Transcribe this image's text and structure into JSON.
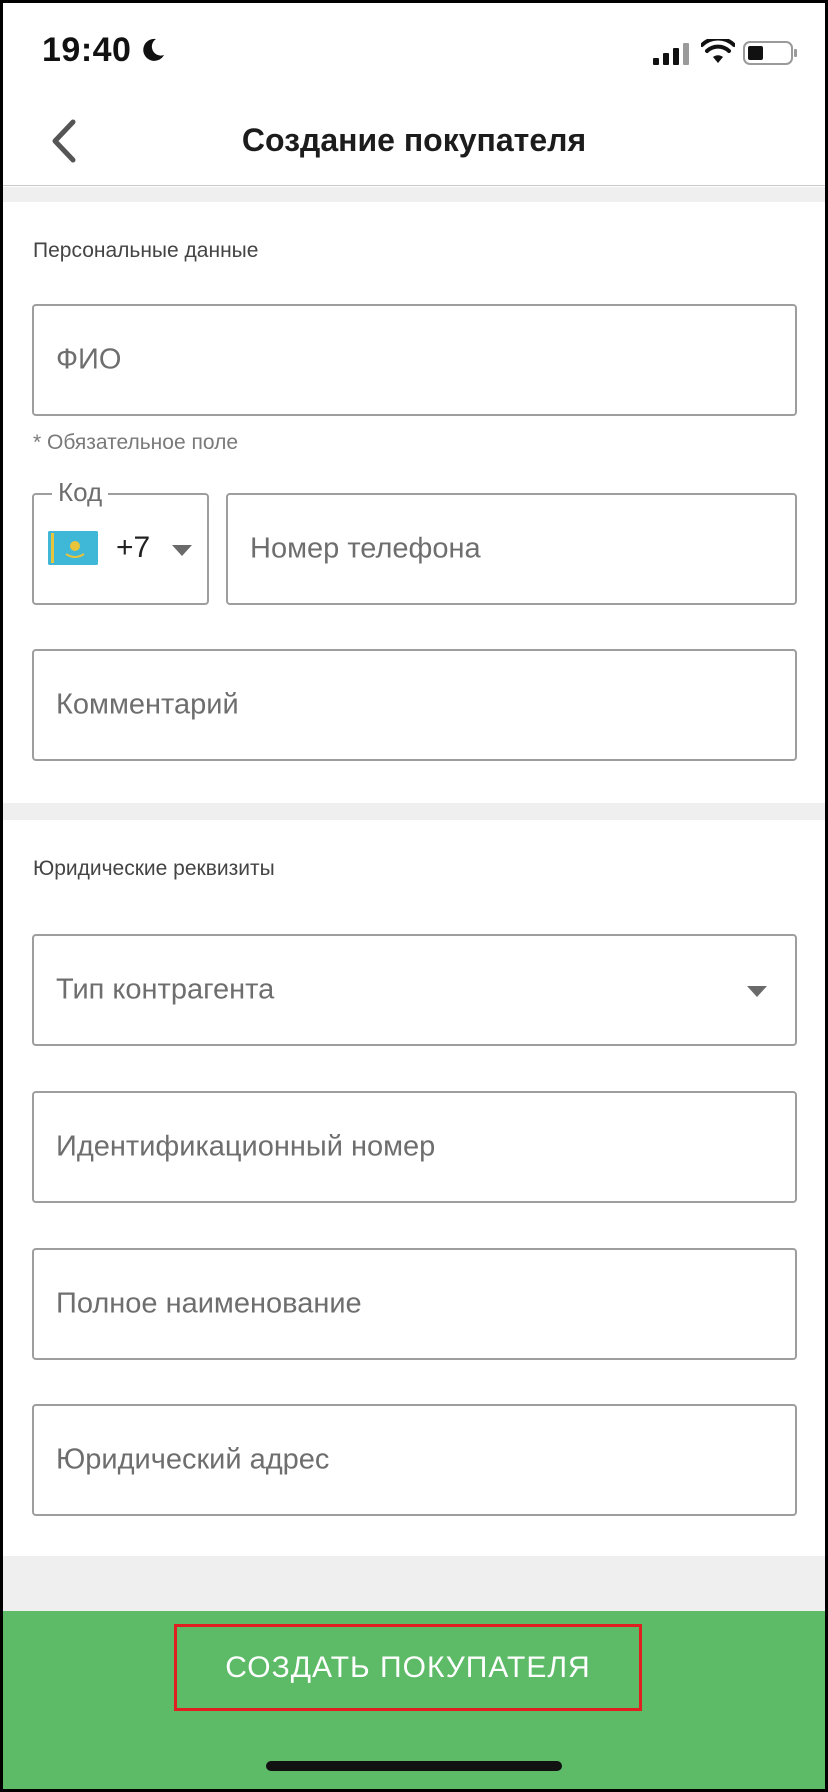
{
  "status_bar": {
    "time": "19:40",
    "icons": [
      "moon-icon",
      "cellular-signal-icon",
      "wifi-icon",
      "battery-icon"
    ]
  },
  "nav": {
    "title": "Создание покупателя",
    "back_icon": "chevron-left-icon"
  },
  "personal": {
    "section_title": "Персональные данные",
    "full_name_placeholder": "ФИО",
    "required_note": "* Обязательное поле",
    "code_label": "Код",
    "country_code": "+7",
    "country_flag": "kazakhstan-flag-icon",
    "phone_placeholder": "Номер телефона",
    "comment_placeholder": "Комментарий"
  },
  "legal": {
    "section_title": "Юридические реквизиты",
    "counterparty_type_placeholder": "Тип контрагента",
    "id_number_placeholder": "Идентификационный номер",
    "full_name_placeholder": "Полное наименование",
    "legal_address_placeholder": "Юридический адрес"
  },
  "footer": {
    "create_button_label": "СОЗДАТЬ ПОКУПАТЕЛЯ"
  },
  "colors": {
    "accent_green": "#5dbb68",
    "highlight_red": "#e02020",
    "border_gray": "#9e9e9e",
    "band_gray": "#efefef"
  }
}
